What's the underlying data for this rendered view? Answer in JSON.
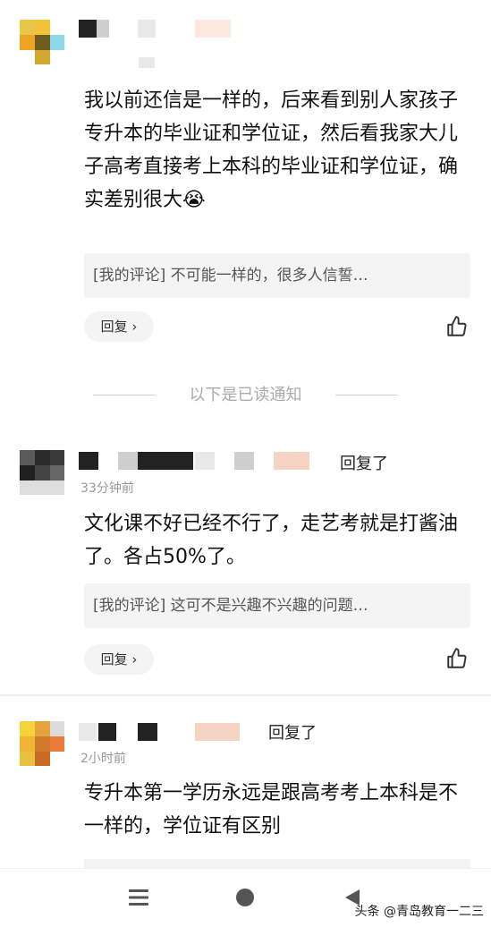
{
  "comments": [
    {
      "body": "我以前还信是一样的，后来看到别人家孩子专升本的毕业证和学位证，然后看我家大儿子高考直接考上本科的毕业证和学位证，确实差别很大",
      "emoji": "😭",
      "quote": "[我的评论] 不可能一样的，很多人信誓…",
      "reply_label": "回复 ›"
    },
    {
      "reply_tag": "回复了",
      "time": "33分钟前",
      "body": "文化课不好已经不行了，走艺考就是打酱油了。各占50%了。",
      "quote": "[我的评论] 这可不是兴趣不兴趣的问题…",
      "reply_label": "回复 ›"
    },
    {
      "reply_tag": "回复了",
      "time": "2小时前",
      "body": "专升本第一学历永远是跟高考考上本科是不一样的，学位证有区别"
    }
  ],
  "separator": "以下是已读通知",
  "icons": {
    "like": "thumbs-up-icon",
    "menu": "menu-icon",
    "home": "home-circle-icon",
    "back": "back-triangle-icon"
  },
  "watermark": "头条 @青岛教育一二三",
  "colors": {
    "text": "#111111",
    "muted": "#999999",
    "quote_bg": "#f4f4f4"
  }
}
